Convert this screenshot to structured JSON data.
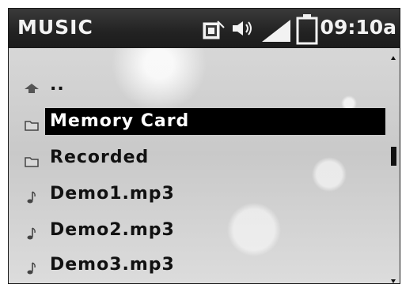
{
  "statusbar": {
    "title": "MUSIC",
    "clock": "09:10a",
    "icons": [
      "card-icon",
      "volume-icon",
      "signal-icon",
      "battery-icon"
    ]
  },
  "list": {
    "items": [
      {
        "label": "..",
        "icon": "parent-folder-icon",
        "selected": false
      },
      {
        "label": "Memory Card",
        "icon": "folder-icon",
        "selected": true
      },
      {
        "label": "Recorded",
        "icon": "folder-icon",
        "selected": false
      },
      {
        "label": "Demo1.mp3",
        "icon": "music-note-icon",
        "selected": false
      },
      {
        "label": "Demo2.mp3",
        "icon": "music-note-icon",
        "selected": false
      },
      {
        "label": "Demo3.mp3",
        "icon": "music-note-icon",
        "selected": false
      }
    ]
  },
  "colors": {
    "statusbar_bg": "#222222",
    "selection_bg": "#000000",
    "text": "#111111"
  }
}
